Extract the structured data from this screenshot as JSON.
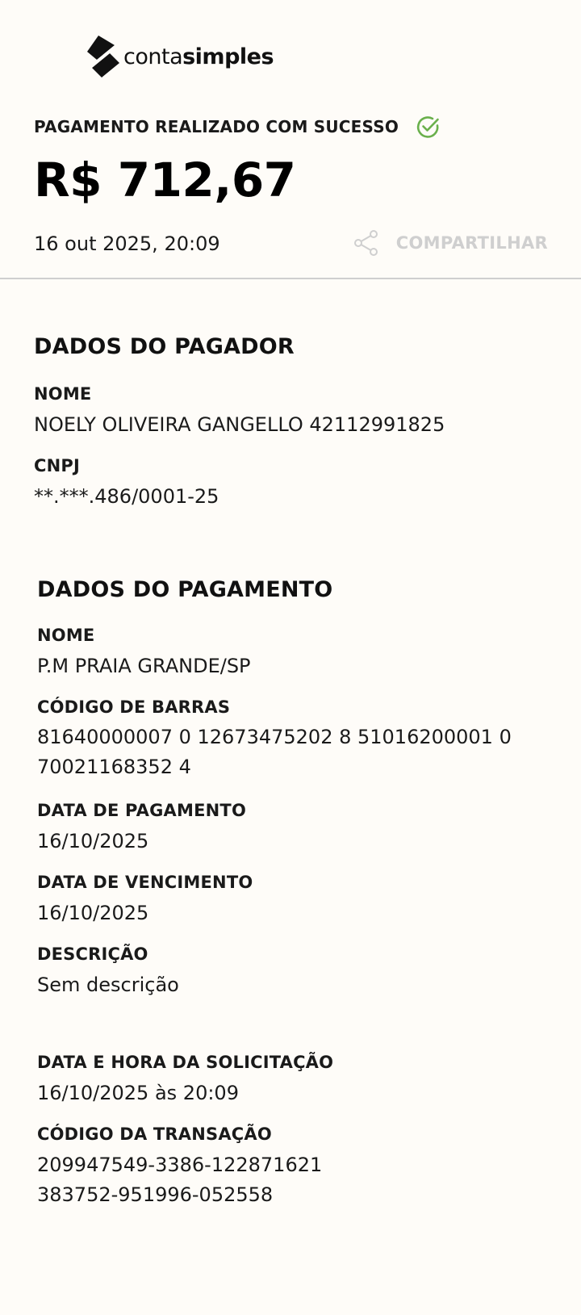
{
  "logo": {
    "text_light": "conta",
    "text_bold": "simples"
  },
  "header": {
    "status": "PAGAMENTO REALIZADO COM SUCESSO",
    "status_icon": "check-circle-icon",
    "status_icon_color": "#6ab04c",
    "amount": "R$ 712,67",
    "datetime": "16 out 2025, 20:09",
    "share_label": "COMPARTILHAR",
    "share_icon": "share-icon"
  },
  "payer": {
    "title": "DADOS DO PAGADOR",
    "name_label": "NOME",
    "name": "NOELY OLIVEIRA GANGELLO 42112991825",
    "cnpj_label": "CNPJ",
    "cnpj": "**.***.486/0001-25"
  },
  "payment": {
    "title": "DADOS DO PAGAMENTO",
    "name_label": "NOME",
    "name": "P.M PRAIA GRANDE/SP",
    "barcode_label": "CÓDIGO DE BARRAS",
    "barcode_line1": "81640000007 0 12673475202 8 51016200001 0",
    "barcode_line2": "70021168352 4",
    "payment_date_label": "DATA DE PAGAMENTO",
    "payment_date": "16/10/2025",
    "due_date_label": "DATA DE VENCIMENTO",
    "due_date": "16/10/2025",
    "description_label": "DESCRIÇÃO",
    "description": "Sem descrição"
  },
  "transaction": {
    "request_label": "DATA E HORA DA SOLICITAÇÃO",
    "request_value": "16/10/2025 às 20:09",
    "code_label": "CÓDIGO DA TRANSAÇÃO",
    "code_line1": "209947549-3386-122871621",
    "code_line2": "383752-951996-052558"
  }
}
